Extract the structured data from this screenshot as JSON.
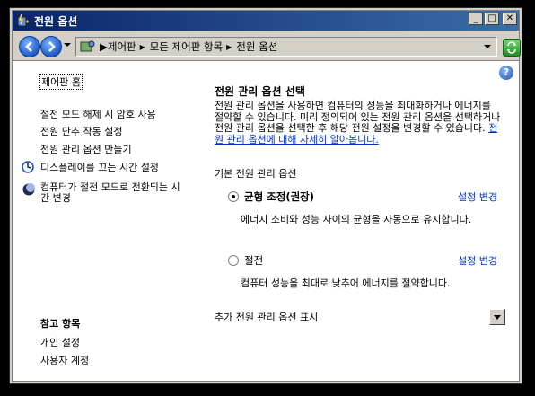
{
  "window": {
    "title": "전원 옵션"
  },
  "address": {
    "crumbs": [
      "제어판",
      "모든 제어판 항목",
      "전원 옵션"
    ]
  },
  "sidebar": {
    "home": "제어판 홈",
    "links": [
      "절전 모드 해제 시 암호 사용",
      "전원 단추 작동 설정",
      "전원 관리 옵션 만들기"
    ],
    "icon_links": [
      {
        "label": "디스플레이를 끄는 시간 설정",
        "icon": "clock-icon"
      },
      {
        "label": "컴퓨터가 절전 모드로 전환되는 시간 변경",
        "icon": "moon-icon"
      }
    ],
    "see_also": {
      "title": "참고 항목",
      "links": [
        "개인 설정",
        "사용자 계정"
      ]
    }
  },
  "main": {
    "heading": "전원 관리 옵션 선택",
    "description": "전원 관리 옵션을 사용하면 컴퓨터의 성능을 최대화하거나 에너지를 절약할 수 있습니다. 미리 정의되어 있는 전원 관리 옵션을 선택하거나 전원 관리 옵션을 선택한 후 해당 전원 설정을 변경할 수 있습니다. ",
    "description_link": "전원 관리 옵션에 대해 자세히 알아봅니다.",
    "group_label": "기본 전원 관리 옵션",
    "plans": [
      {
        "name": "균형 조정(권장)",
        "selected": true,
        "change": "설정 변경",
        "desc": "에너지 소비와 성능 사이의 균형을 자동으로 유지합니다."
      },
      {
        "name": "절전",
        "selected": false,
        "change": "설정 변경",
        "desc": "컴퓨터 성능을 최대로 낮추어 에너지를 절약합니다."
      }
    ],
    "more_label": "추가 전원 관리 옵션 표시"
  },
  "colors": {
    "titlebar_start": "#0a246a",
    "titlebar_end": "#3a6ea5",
    "link": "#0033cc",
    "chrome": "#d4d0c8"
  }
}
